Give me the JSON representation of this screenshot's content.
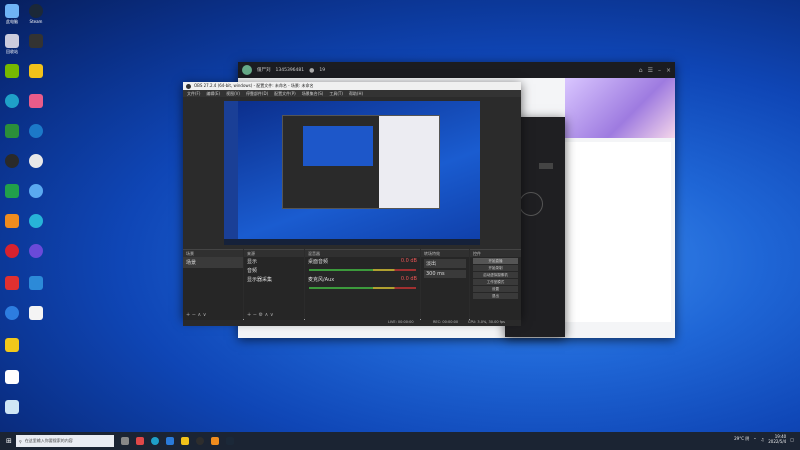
{
  "desktop": {
    "icons": [
      "此电脑",
      "Steam",
      "回收站",
      "",
      "",
      "",
      "",
      "",
      "",
      "",
      "",
      "",
      "",
      "",
      "",
      "",
      "",
      "",
      "",
      "",
      "",
      "",
      ""
    ]
  },
  "qq": {
    "username": "僵尸刘",
    "id": "1345396481",
    "online_count": "19"
  },
  "obs": {
    "title": "OBS 27.2.4 (64-bit, windows) - 配置文件: 未命名 - 场景: 未命名",
    "menu": [
      "文件(F)",
      "编辑(E)",
      "视图(V)",
      "停靠部件(D)",
      "配置文件(P)",
      "场景集合(S)",
      "工具(T)",
      "帮助(H)"
    ],
    "scenes_title": "场景",
    "scene_item": "场景",
    "sources_title": "来源",
    "sources": [
      "显示",
      "音频",
      "显示器采集"
    ],
    "mixer_title": "混音器",
    "mixer_tracks": [
      {
        "name": "桌面音频",
        "db": "0.0 dB"
      },
      {
        "name": "麦克风/Aux",
        "db": "0.0 dB"
      }
    ],
    "transitions_title": "转场特效",
    "transition": "淡出",
    "duration": "300 ms",
    "controls_title": "控件",
    "controls": [
      "开始直播",
      "开始录制",
      "启动虚拟摄像机",
      "工作室模式",
      "设置",
      "退出"
    ],
    "status": [
      "LIVE: 00:00:00",
      "REC: 00:00:00",
      "CPU: 3.0%, 30.00 fps"
    ],
    "record_hint": "录制中"
  },
  "taskbar": {
    "search_placeholder": "在这里输入你要搜索的内容",
    "weather": "29°C 阴",
    "time": "19:40",
    "date": "2022/5/4"
  }
}
